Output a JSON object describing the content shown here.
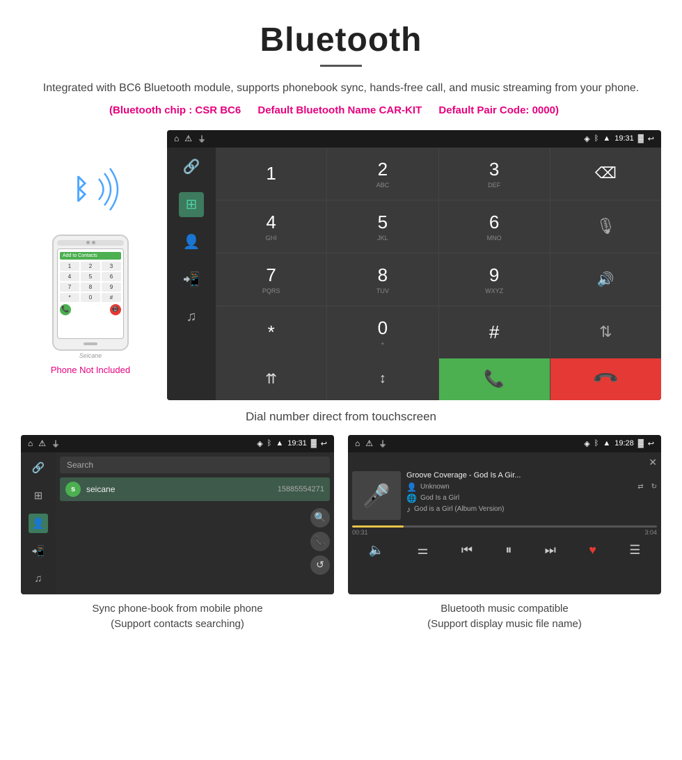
{
  "header": {
    "title": "Bluetooth",
    "description": "Integrated with BC6 Bluetooth module, supports phonebook sync, hands-free call, and music streaming from your phone.",
    "spec1": "(Bluetooth chip : CSR BC6",
    "spec2": "Default Bluetooth Name CAR-KIT",
    "spec3": "Default Pair Code: 0000)",
    "phone_not_included": "Phone Not Included"
  },
  "dial_screen": {
    "status_time": "19:31",
    "caption": "Dial number direct from touchscreen",
    "keys": [
      {
        "digit": "1",
        "sub": ""
      },
      {
        "digit": "2",
        "sub": "ABC"
      },
      {
        "digit": "3",
        "sub": "DEF"
      },
      {
        "digit": "backspace",
        "sub": ""
      },
      {
        "digit": "4",
        "sub": "GHI"
      },
      {
        "digit": "5",
        "sub": "JKL"
      },
      {
        "digit": "6",
        "sub": "MNO"
      },
      {
        "digit": "mute",
        "sub": ""
      },
      {
        "digit": "7",
        "sub": "PQRS"
      },
      {
        "digit": "8",
        "sub": "TUV"
      },
      {
        "digit": "9",
        "sub": "WXYZ"
      },
      {
        "digit": "volume",
        "sub": ""
      },
      {
        "digit": "*",
        "sub": ""
      },
      {
        "digit": "0",
        "sub": "+"
      },
      {
        "digit": "#",
        "sub": ""
      },
      {
        "digit": "swap",
        "sub": ""
      }
    ]
  },
  "phonebook_screen": {
    "status_time": "19:31",
    "search_placeholder": "Search",
    "contact_name": "seicane",
    "contact_phone": "15885554271",
    "contact_initial": "s",
    "caption_line1": "Sync phone-book from mobile phone",
    "caption_line2": "(Support contacts searching)"
  },
  "music_screen": {
    "status_time": "19:28",
    "song_title": "Groove Coverage - God Is A Gir...",
    "artist": "Unknown",
    "album": "God Is a Girl",
    "track": "God is a Girl (Album Version)",
    "current_time": "00:31",
    "total_time": "3:04",
    "progress_percent": 17,
    "caption_line1": "Bluetooth music compatible",
    "caption_line2": "(Support display music file name)"
  },
  "icons": {
    "bluetooth": "ᛒ",
    "home": "⌂",
    "warning": "⚠",
    "usb": "⏚",
    "location": "◈",
    "battery": "▓",
    "back_arrow": "↩",
    "link": "🔗",
    "dialpad": "⊞",
    "contact": "👤",
    "call_forward": "📲",
    "music_note": "♫",
    "backspace_key": "⌫",
    "mute": "🎤",
    "volume": "🔊",
    "swap": "⇅",
    "merge": "⇈",
    "hold": "⇧",
    "phone_call": "📞",
    "end_call": "📵",
    "search": "🔍",
    "call_green": "📞",
    "refresh": "↺",
    "mic_large": "🎤",
    "shuffle": "⇄",
    "repeat": "↻",
    "prev": "⏮",
    "play_pause": "⏸",
    "next": "⏭",
    "heart": "♥",
    "playlist": "☰",
    "volume_music": "🔈",
    "equalizer": "⚌",
    "close": "✕"
  }
}
